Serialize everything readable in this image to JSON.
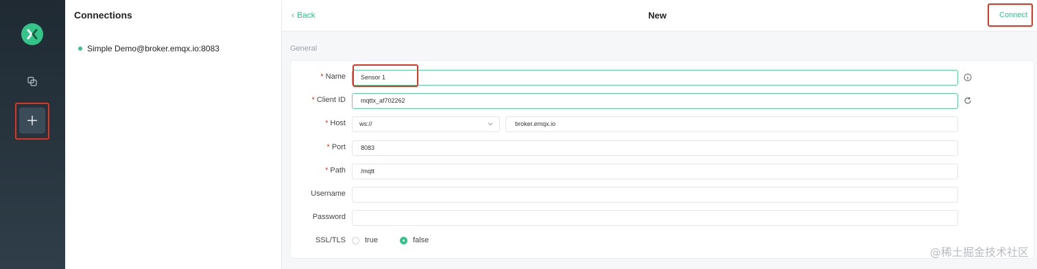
{
  "sidebar": {
    "logo_icon": "mqttx-logo-icon",
    "connections_icon": "copy-icon",
    "add_icon": "plus-icon"
  },
  "connections": {
    "title": "Connections",
    "items": [
      {
        "label": "Simple Demo@broker.emqx.io:8083",
        "status_color": "#34c388"
      }
    ]
  },
  "header": {
    "back_label": "Back",
    "title": "New",
    "connect_label": "Connect"
  },
  "form": {
    "section_label": "General",
    "name": {
      "label": "Name",
      "required_mark": "*",
      "value": "Sensor 1",
      "info_icon": "info-circle-icon"
    },
    "client_id": {
      "label": "Client ID",
      "required_mark": "*",
      "value": "mqttx_af702262",
      "refresh_icon": "refresh-icon"
    },
    "host": {
      "label": "Host",
      "required_mark": "*",
      "protocol": "ws://",
      "value": "broker.emqx.io"
    },
    "port": {
      "label": "Port",
      "required_mark": "*",
      "value": "8083"
    },
    "path": {
      "label": "Path",
      "required_mark": "*",
      "value": "/mqtt"
    },
    "username": {
      "label": "Username",
      "value": ""
    },
    "password": {
      "label": "Password",
      "value": ""
    },
    "ssl_tls": {
      "label": "SSL/TLS",
      "options": [
        "true",
        "false"
      ],
      "selected": "false"
    }
  },
  "watermark": "@稀土掘金技术社区",
  "colors": {
    "accent": "#34c388",
    "highlight": "#e0341e",
    "sidebar_bg": "#26333d"
  }
}
